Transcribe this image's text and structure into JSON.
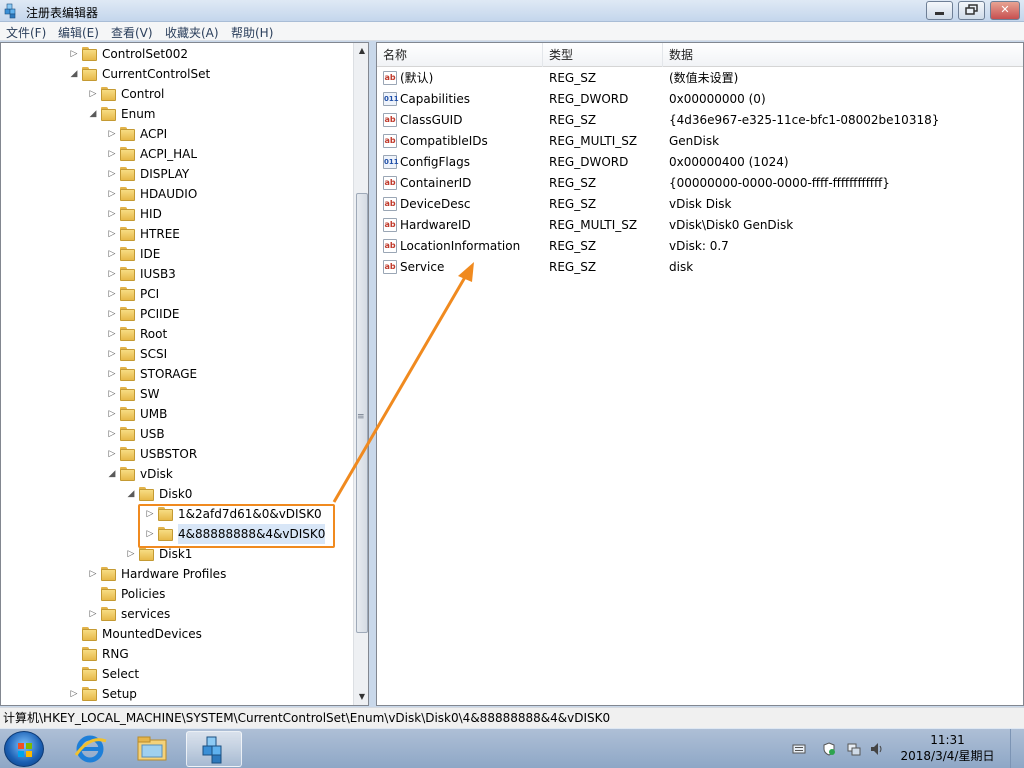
{
  "window": {
    "title": "注册表编辑器",
    "min_label": "0",
    "max_label": "□",
    "close_label": "✕"
  },
  "menu": [
    "文件(F)",
    "编辑(E)",
    "查看(V)",
    "收藏夹(A)",
    "帮助(H)"
  ],
  "tree": [
    {
      "label": "ControlSet002",
      "indent": 0,
      "expander": "▷"
    },
    {
      "label": "CurrentControlSet",
      "indent": 0,
      "expander": "◢"
    },
    {
      "label": "Control",
      "indent": 1,
      "expander": "▷"
    },
    {
      "label": "Enum",
      "indent": 1,
      "expander": "◢"
    },
    {
      "label": "ACPI",
      "indent": 2,
      "expander": "▷"
    },
    {
      "label": "ACPI_HAL",
      "indent": 2,
      "expander": "▷"
    },
    {
      "label": "DISPLAY",
      "indent": 2,
      "expander": "▷"
    },
    {
      "label": "HDAUDIO",
      "indent": 2,
      "expander": "▷"
    },
    {
      "label": "HID",
      "indent": 2,
      "expander": "▷"
    },
    {
      "label": "HTREE",
      "indent": 2,
      "expander": "▷"
    },
    {
      "label": "IDE",
      "indent": 2,
      "expander": "▷"
    },
    {
      "label": "IUSB3",
      "indent": 2,
      "expander": "▷"
    },
    {
      "label": "PCI",
      "indent": 2,
      "expander": "▷"
    },
    {
      "label": "PCIIDE",
      "indent": 2,
      "expander": "▷"
    },
    {
      "label": "Root",
      "indent": 2,
      "expander": "▷"
    },
    {
      "label": "SCSI",
      "indent": 2,
      "expander": "▷"
    },
    {
      "label": "STORAGE",
      "indent": 2,
      "expander": "▷"
    },
    {
      "label": "SW",
      "indent": 2,
      "expander": "▷"
    },
    {
      "label": "UMB",
      "indent": 2,
      "expander": "▷"
    },
    {
      "label": "USB",
      "indent": 2,
      "expander": "▷"
    },
    {
      "label": "USBSTOR",
      "indent": 2,
      "expander": "▷"
    },
    {
      "label": "vDisk",
      "indent": 2,
      "expander": "◢"
    },
    {
      "label": "Disk0",
      "indent": 3,
      "expander": "◢"
    },
    {
      "label": "1&2afd7d61&0&vDISK0",
      "indent": 4,
      "expander": "▷"
    },
    {
      "label": "4&88888888&4&vDISK0",
      "indent": 4,
      "expander": "▷"
    },
    {
      "label": "Disk1",
      "indent": 3,
      "expander": "▷"
    },
    {
      "label": "Hardware Profiles",
      "indent": 1,
      "expander": "▷"
    },
    {
      "label": "Policies",
      "indent": 1,
      "expander": ""
    },
    {
      "label": "services",
      "indent": 1,
      "expander": "▷"
    },
    {
      "label": "MountedDevices",
      "indent": 0,
      "expander": ""
    },
    {
      "label": "RNG",
      "indent": 0,
      "expander": ""
    },
    {
      "label": "Select",
      "indent": 0,
      "expander": ""
    },
    {
      "label": "Setup",
      "indent": 0,
      "expander": "▷"
    }
  ],
  "list": {
    "headers": [
      "名称",
      "类型",
      "数据"
    ],
    "rows": [
      {
        "icon": "string-value-icon",
        "name": "(默认)",
        "type": "REG_SZ",
        "data": "(数值未设置)"
      },
      {
        "icon": "binary-value-icon",
        "name": "Capabilities",
        "type": "REG_DWORD",
        "data": "0x00000000 (0)"
      },
      {
        "icon": "string-value-icon",
        "name": "ClassGUID",
        "type": "REG_SZ",
        "data": "{4d36e967-e325-11ce-bfc1-08002be10318}"
      },
      {
        "icon": "string-value-icon",
        "name": "CompatibleIDs",
        "type": "REG_MULTI_SZ",
        "data": "GenDisk"
      },
      {
        "icon": "binary-value-icon",
        "name": "ConfigFlags",
        "type": "REG_DWORD",
        "data": "0x00000400 (1024)"
      },
      {
        "icon": "string-value-icon",
        "name": "ContainerID",
        "type": "REG_SZ",
        "data": "{00000000-0000-0000-ffff-ffffffffffff}"
      },
      {
        "icon": "string-value-icon",
        "name": "DeviceDesc",
        "type": "REG_SZ",
        "data": "vDisk Disk"
      },
      {
        "icon": "string-value-icon",
        "name": "HardwareID",
        "type": "REG_MULTI_SZ",
        "data": "vDisk\\Disk0 GenDisk"
      },
      {
        "icon": "string-value-icon",
        "name": "LocationInformation",
        "type": "REG_SZ",
        "data": "vDisk: 0.7"
      },
      {
        "icon": "string-value-icon",
        "name": "Service",
        "type": "REG_SZ",
        "data": "disk"
      }
    ]
  },
  "status": {
    "path": "计算机\\HKEY_LOCAL_MACHINE\\SYSTEM\\CurrentControlSet\\Enum\\vDisk\\Disk0\\4&88888888&4&vDISK0"
  },
  "taskbar": {
    "time": "11:31",
    "date": "2018/3/4/星期日"
  },
  "colors": {
    "annotation": "#f08a1f",
    "string_icon": "#c0392b",
    "binary_icon": "#1f4fa8"
  }
}
